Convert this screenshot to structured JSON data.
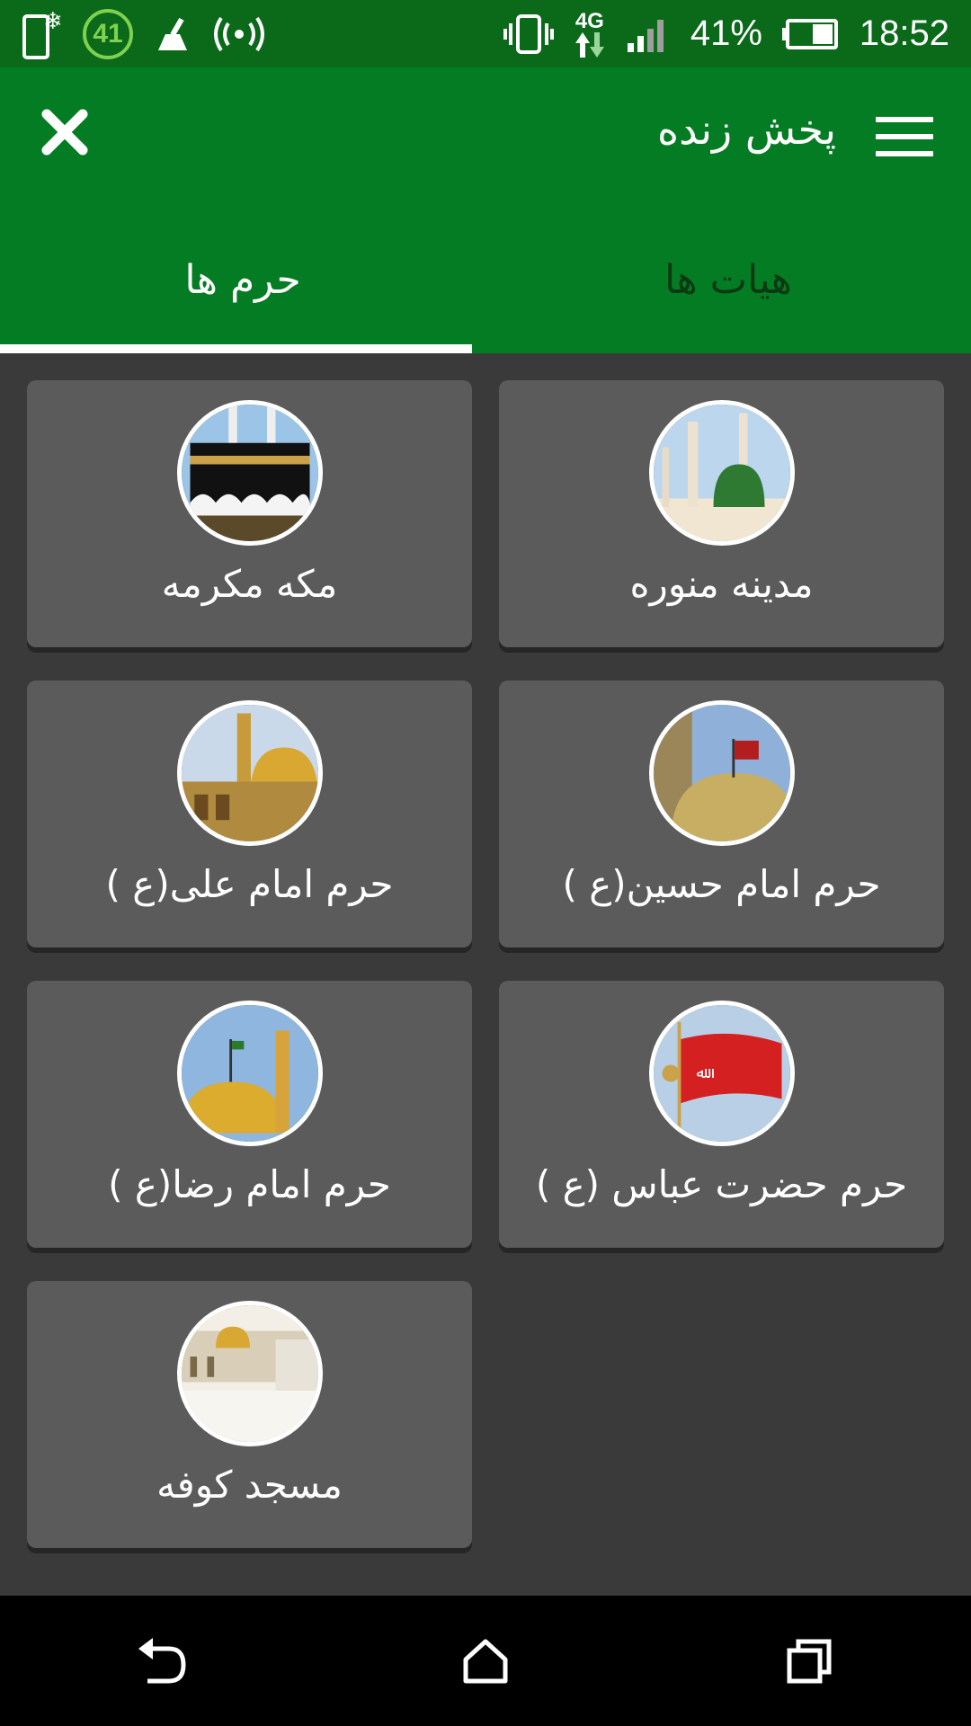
{
  "status_bar": {
    "badge": "41",
    "network": "4G",
    "battery": "41%",
    "time": "18:52"
  },
  "app_bar": {
    "title": "پخش زنده"
  },
  "tabs": [
    {
      "label": "هیات ها",
      "active": false
    },
    {
      "label": "حرم ها",
      "active": true
    }
  ],
  "shrines": [
    {
      "label": "مدینه منوره",
      "image": "medina-mosque"
    },
    {
      "label": "مکه مکرمه",
      "image": "kaaba"
    },
    {
      "label": "حرم امام حسین(ع )",
      "image": "imam-hussain-shrine"
    },
    {
      "label": "حرم امام علی(ع )",
      "image": "imam-ali-shrine"
    },
    {
      "label": "حرم حضرت عباس (ع )",
      "image": "red-flag"
    },
    {
      "label": "حرم امام رضا(ع )",
      "image": "imam-reza-shrine"
    },
    {
      "label": "مسجد کوفه",
      "image": "kufa-mosque"
    }
  ],
  "colors": {
    "status_bar": "#0b6a1a",
    "app_bar": "#047c23",
    "background": "#3a3a3a",
    "card": "#5b5b5b"
  }
}
